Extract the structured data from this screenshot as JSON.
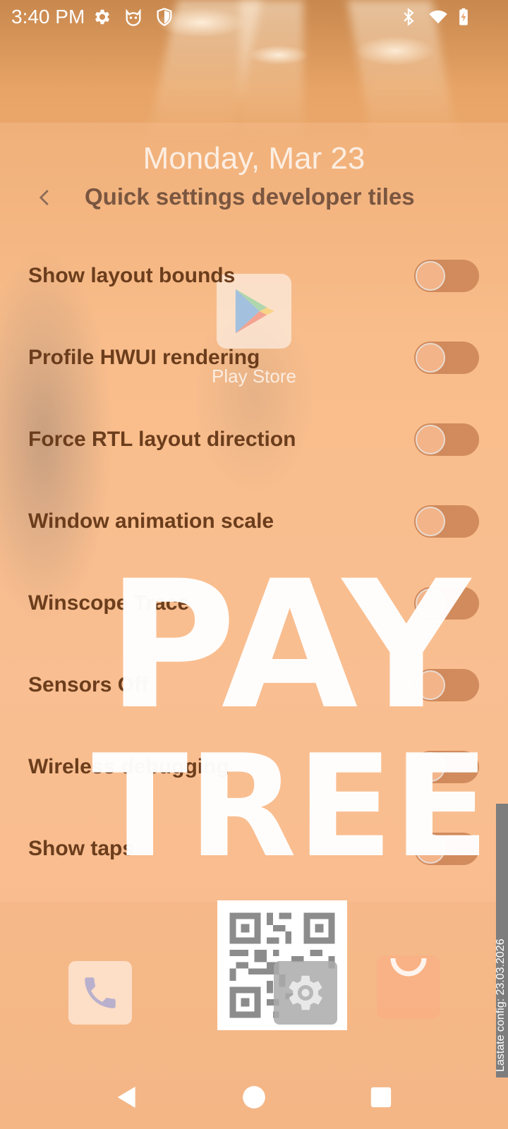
{
  "status_bar": {
    "time": "3:40 PM",
    "left_icons": [
      "gear-icon",
      "cat-face-icon",
      "shield-icon"
    ],
    "right_icons": [
      "bluetooth-icon",
      "wifi-icon",
      "battery-charging-icon"
    ]
  },
  "home_remnants": {
    "date": "Monday, Mar 23",
    "play_store_label": "Play Store",
    "watermark_line1": "PAY",
    "watermark_line2": "TREE",
    "side_strip_text": "Lastate config: 23.03.2026"
  },
  "header": {
    "back_icon": "chevron-left-icon",
    "title": "Quick settings developer tiles"
  },
  "tiles": [
    {
      "label": "Show layout bounds",
      "enabled": false
    },
    {
      "label": "Profile HWUI rendering",
      "enabled": false
    },
    {
      "label": "Force RTL layout direction",
      "enabled": false
    },
    {
      "label": "Window animation scale",
      "enabled": false
    },
    {
      "label": "Winscope Trace",
      "enabled": false
    },
    {
      "label": "Sensors Off",
      "enabled": false
    },
    {
      "label": "Wireless debugging",
      "enabled": false
    },
    {
      "label": "Show taps",
      "enabled": false
    }
  ],
  "dock": {
    "apps": [
      "phone-icon",
      "qr-code-icon",
      "gear-icon",
      "shopping-bag-icon"
    ]
  },
  "nav_bar": {
    "buttons": [
      "back-triangle-icon",
      "home-circle-icon",
      "recents-square-icon"
    ]
  },
  "colors": {
    "title": "#7a5640",
    "tile_label": "#6b3d1c",
    "toggle_track": "#cf885a",
    "background": "#f3b88a"
  }
}
